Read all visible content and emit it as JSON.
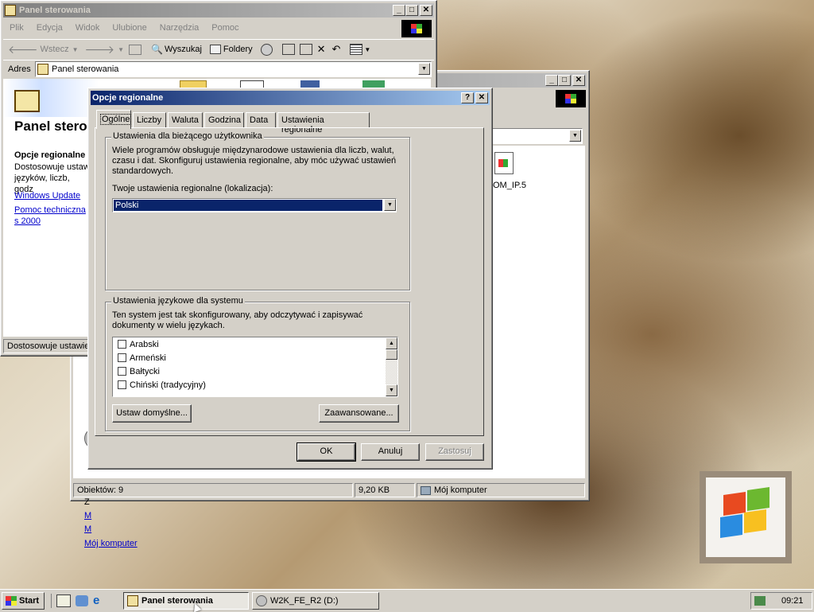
{
  "back_window": {
    "title": "Panel sterowania",
    "menu": [
      "Plik",
      "Edycja",
      "Widok",
      "Ulubione",
      "Narzędzia",
      "Pomoc"
    ],
    "toolbar": {
      "back_label": "Wstecz",
      "search_label": "Wyszukaj",
      "folders_label": "Foldery"
    },
    "address_label": "Adres",
    "address_value": "Panel sterowania",
    "heading": "Panel stero",
    "selected_item_title": "Opcje regionalne",
    "selected_item_desc": "Dostosowuje ustaw języków, liczb, godz",
    "links": [
      "Windows Update",
      "Pomoc techniczna s 2000"
    ],
    "status_text": "Dostosowuje ustawier"
  },
  "second_window": {
    "file_name": "OM_IP.5",
    "left_links": [
      "Z",
      "M",
      "M"
    ],
    "my_computer_link": "Mój komputer",
    "status": {
      "objects": "Obiektów: 9",
      "size": "9,20 KB",
      "location": "Mój komputer"
    }
  },
  "dialog": {
    "title": "Opcje regionalne",
    "help_btn": "?",
    "close_btn": "✕",
    "tabs": [
      "Ogólne",
      "Liczby",
      "Waluta",
      "Godzina",
      "Data",
      "Ustawienia regionalne"
    ],
    "user_group": {
      "label": "Ustawienia dla bieżącego użytkownika",
      "desc": "Wiele programów obsługuje międzynarodowe ustawienia dla liczb, walut, czasu i dat. Skonfiguruj ustawienia regionalne, aby móc używać ustawień standardowych.",
      "locale_label": "Twoje ustawienia regionalne (lokalizacja):",
      "locale_value": "Polski"
    },
    "system_group": {
      "label": "Ustawienia językowe dla systemu",
      "desc": "Ten system jest tak skonfigurowany, aby odczytywać i zapisywać dokumenty w wielu językach.",
      "languages": [
        "Arabski",
        "Armeński",
        "Bałtycki",
        "Chiński (tradycyjny)"
      ],
      "default_btn": "Ustaw domyślne...",
      "advanced_btn": "Zaawansowane..."
    },
    "buttons": {
      "ok": "OK",
      "cancel": "Anuluj",
      "apply": "Zastosuj"
    }
  },
  "taskbar": {
    "start": "Start",
    "tasks": [
      "Panel sterowania",
      "W2K_FE_R2 (D:)"
    ],
    "clock": "09:21"
  }
}
